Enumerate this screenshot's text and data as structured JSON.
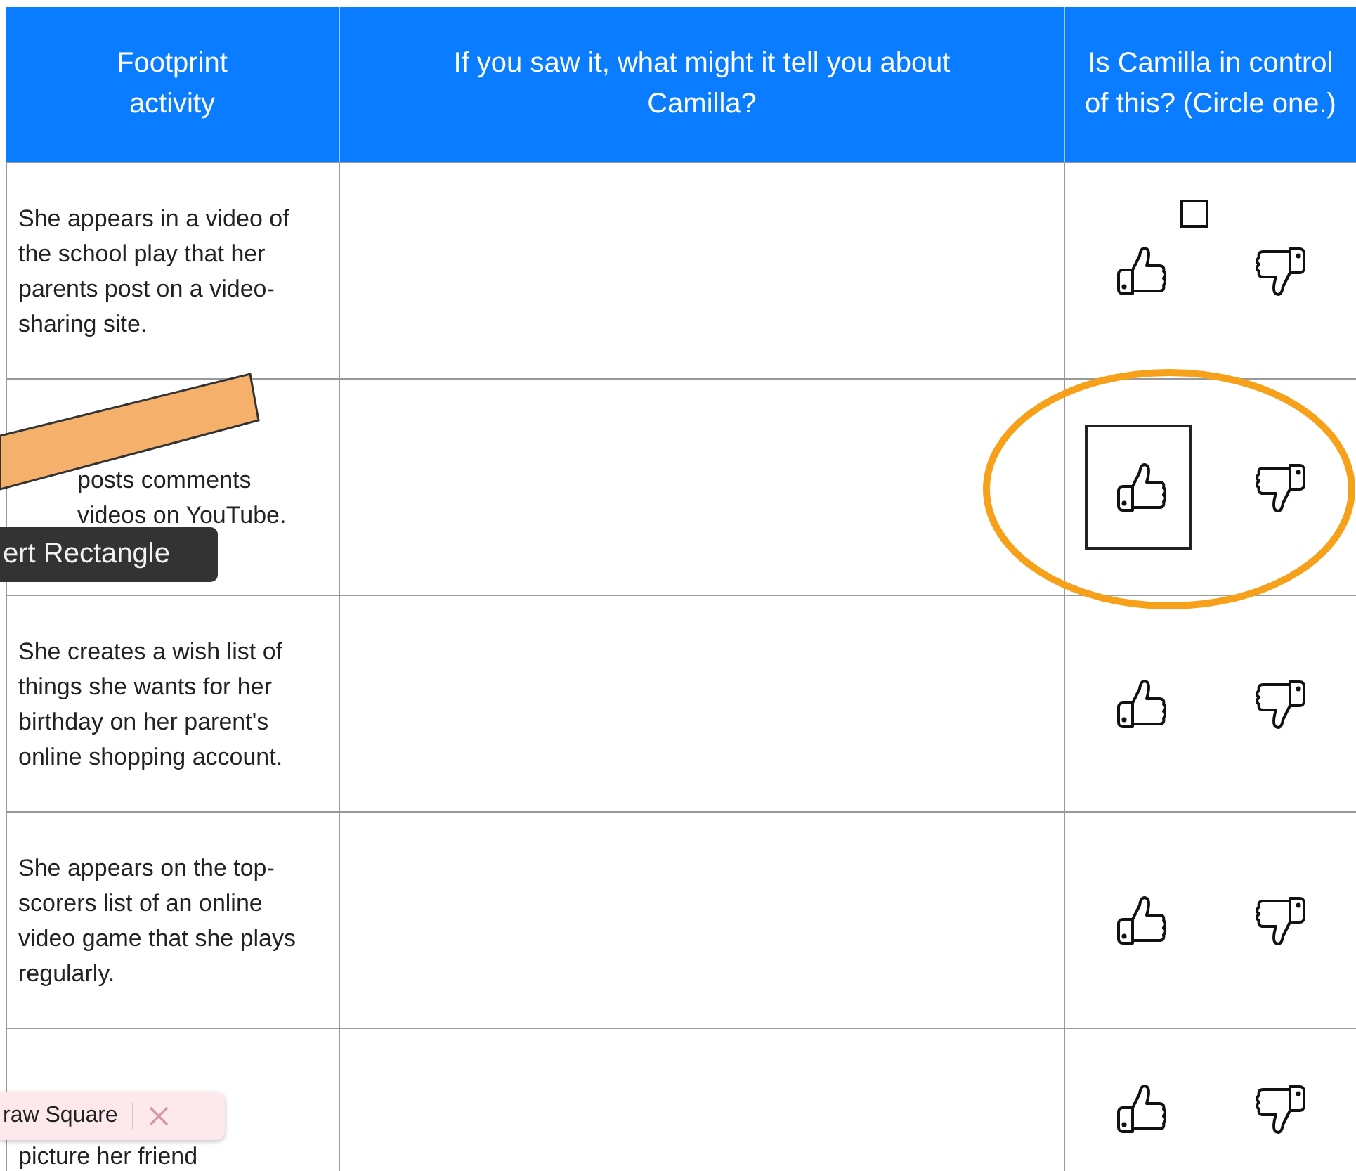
{
  "table": {
    "columns": [
      "Footprint activity",
      "If you saw it, what might it tell you about Camilla?",
      "Is Camilla in control of this? (Circle one.)"
    ],
    "rows": [
      {
        "activity": "She appears in a video of the school play that her parents post on a video-sharing site.",
        "marker": true,
        "circled": false,
        "thumbs": [
          {
            "kind": "up",
            "selected": false
          },
          {
            "kind": "down",
            "selected": false
          }
        ]
      },
      {
        "activity": "posts comments videos on YouTube.",
        "marker": false,
        "circled": true,
        "thumbs": [
          {
            "kind": "up",
            "selected": true
          },
          {
            "kind": "down",
            "selected": false
          }
        ]
      },
      {
        "activity": "She creates a wish list of things she wants for her birthday on her parent's online shopping account.",
        "marker": false,
        "circled": false,
        "thumbs": [
          {
            "kind": "up",
            "selected": false
          },
          {
            "kind": "down",
            "selected": false
          }
        ]
      },
      {
        "activity": "She appears on the top-scorers list of an online video game that she plays regularly.",
        "marker": false,
        "circled": false,
        "thumbs": [
          {
            "kind": "up",
            "selected": false
          },
          {
            "kind": "down",
            "selected": false
          }
        ]
      },
      {
        "activity": "picture her friend",
        "marker": false,
        "circled": false,
        "thumbs": [
          {
            "kind": "up",
            "selected": false
          },
          {
            "kind": "down",
            "selected": false
          }
        ]
      }
    ]
  },
  "overlays": [
    {
      "kind": "stroke"
    },
    {
      "kind": "tooltip",
      "text": "ert Rectangle"
    },
    {
      "kind": "toolbar",
      "text": "raw Square"
    }
  ]
}
